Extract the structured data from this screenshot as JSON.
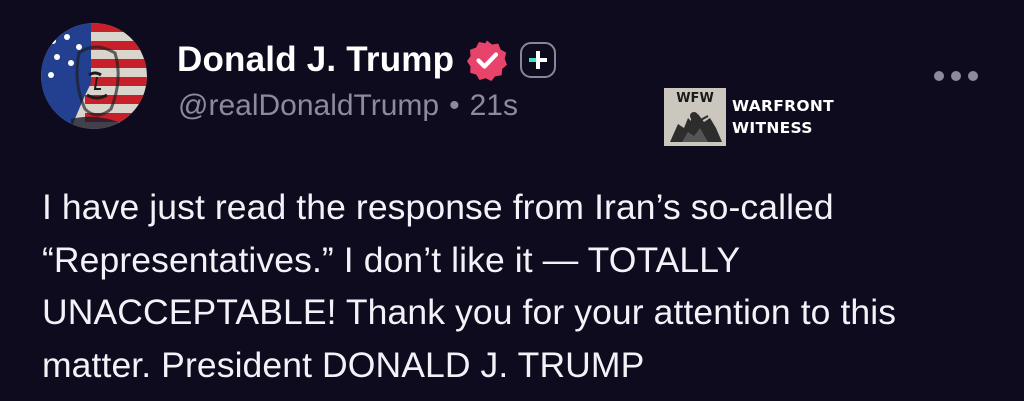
{
  "post": {
    "author": {
      "display_name": "Donald J. Trump",
      "handle": "@realDonaldTrump",
      "verified_icon": "verified-badge-icon",
      "verified_color": "#e8436b",
      "follow_icon": "plus-icon",
      "follow_icon_color": "#3ee3c6"
    },
    "meta": {
      "separator": "•",
      "timestamp": "21s"
    },
    "body_text": "I have just read the response from Iran’s so-called “Representatives.” I don’t like it — TOTALLY UNACCEPTABLE! Thank you for your attention to this matter. President DONALD J. TRUMP",
    "more_icon": "more-options-icon"
  },
  "watermark": {
    "logo_text": "WFW",
    "line1": "WARFRONT",
    "line2": "WITNESS"
  },
  "colors": {
    "background": "#0f0b1e",
    "text": "#f4f2f8",
    "muted": "#8e8a9c"
  }
}
